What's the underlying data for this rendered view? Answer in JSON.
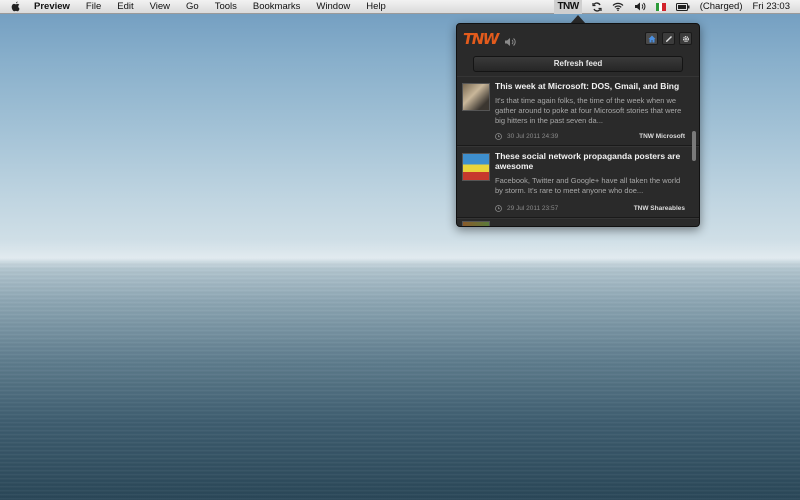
{
  "menubar": {
    "app_name": "Preview",
    "items": [
      "File",
      "Edit",
      "View",
      "Go",
      "Tools",
      "Bookmarks",
      "Window",
      "Help"
    ],
    "status": {
      "tnw_label": "TNW",
      "battery_text": "(Charged)",
      "clock": "Fri 23:03"
    }
  },
  "popover": {
    "logo_text": "TNW",
    "refresh_label": "Refresh feed",
    "brand_color": "#e35b1c",
    "feed": [
      {
        "title": "This week at Microsoft: DOS, Gmail, and Bing",
        "excerpt": "It's that time again folks, the time of the week when we gather around to poke at four Microsoft stories that were big hitters in the past seven da...",
        "date": "30 Jul 2011 24:39",
        "category": "TNW Microsoft"
      },
      {
        "title": "These social network propaganda posters are awesome",
        "excerpt": "Facebook, Twitter and Google+ have all taken the world by storm. It's rare to meet anyone who doe...",
        "date": "29 Jul 2011 23:57",
        "category": "TNW Shareables"
      }
    ]
  }
}
